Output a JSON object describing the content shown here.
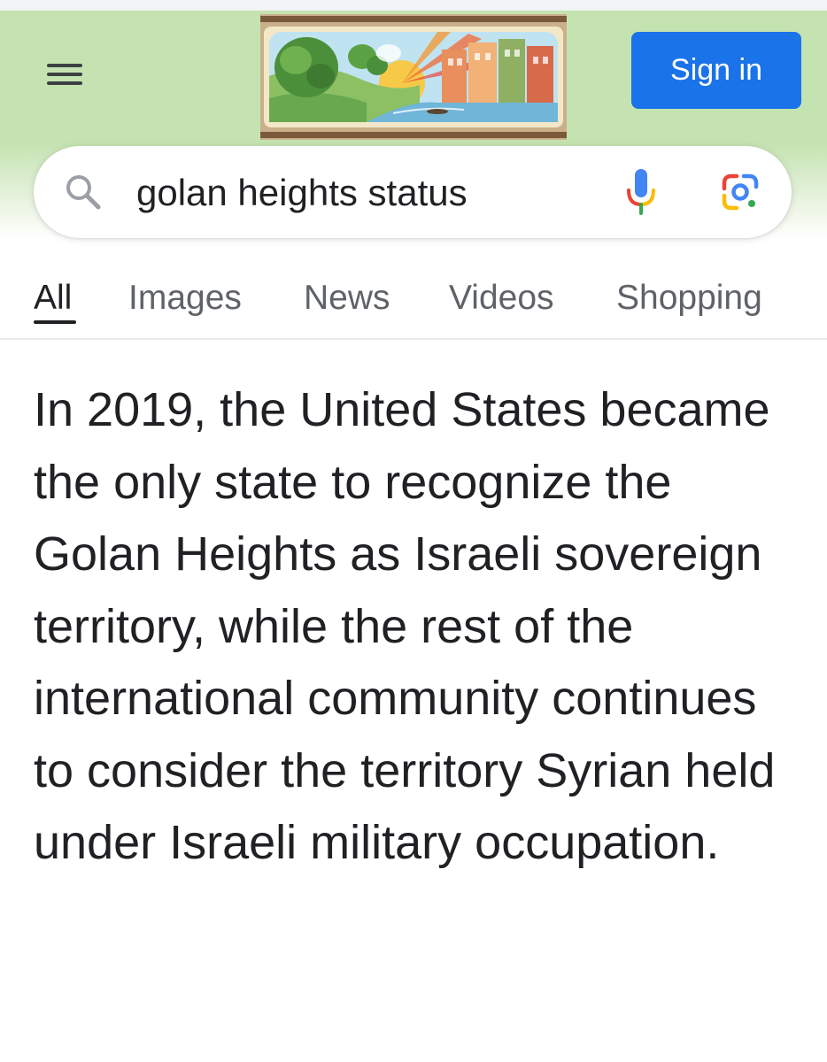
{
  "header": {
    "sign_in_label": "Sign in",
    "accent_color": "#1a73e8",
    "background_color": "#c5e3b1"
  },
  "search": {
    "query": "golan heights status"
  },
  "tabs": [
    {
      "label": "All",
      "active": true
    },
    {
      "label": "Images",
      "active": false
    },
    {
      "label": "News",
      "active": false
    },
    {
      "label": "Videos",
      "active": false
    },
    {
      "label": "Shopping",
      "active": false
    }
  ],
  "answer": {
    "text": "In 2019, the United States became the only state to recognize the Golan Heights as Israeli sovereign territory, while the rest of the international community continues to consider the territory Syrian held under Israeli military occupation."
  },
  "icons": {
    "menu": "hamburger-menu-icon",
    "doodle": "google-doodle-landscape",
    "search": "search-icon",
    "mic": "microphone-icon",
    "lens": "google-lens-icon"
  }
}
